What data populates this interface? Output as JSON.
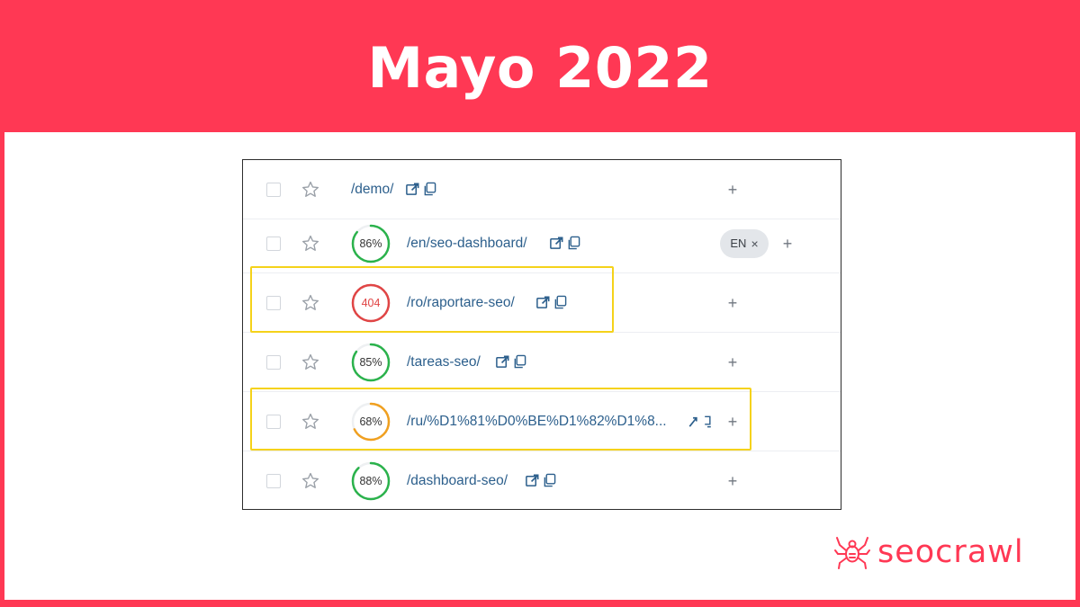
{
  "header": {
    "title": "Mayo 2022"
  },
  "brand": {
    "name": "seocrawl",
    "accent": "#ff3854"
  },
  "table": {
    "rows": [
      {
        "url": "/demo/",
        "score": "",
        "status": "none",
        "tag": "",
        "plus": "+"
      },
      {
        "url": "/en/seo-dashboard/",
        "score": "86%",
        "score_value": 0.86,
        "status": "good",
        "tag": "EN",
        "tag_remove": "×",
        "plus": "+"
      },
      {
        "url": "/ro/raportare-seo/",
        "score": "404",
        "score_value": 1.0,
        "status": "error",
        "tag": "",
        "plus": "+",
        "highlighted": true
      },
      {
        "url": "/tareas-seo/",
        "score": "85%",
        "score_value": 0.85,
        "status": "good",
        "tag": "",
        "plus": "+"
      },
      {
        "url": "/ru/%D1%81%D0%BE%D1%82%D1%8...",
        "score": "68%",
        "score_value": 0.68,
        "status": "medium",
        "tag": "",
        "plus": "+",
        "highlighted": true
      },
      {
        "url": "/dashboard-seo/",
        "score": "88%",
        "score_value": 0.88,
        "status": "good",
        "tag": "",
        "plus": "+"
      }
    ]
  },
  "colors": {
    "good": "#2bb24c",
    "medium": "#f0a020",
    "error": "#e04545",
    "link": "#2c5f8c",
    "highlight": "#f5d21a"
  },
  "icons": {
    "checkbox": "checkbox-icon",
    "star": "star-icon",
    "external": "external-link-icon",
    "copy": "copy-icon",
    "logo": "spider-icon"
  }
}
